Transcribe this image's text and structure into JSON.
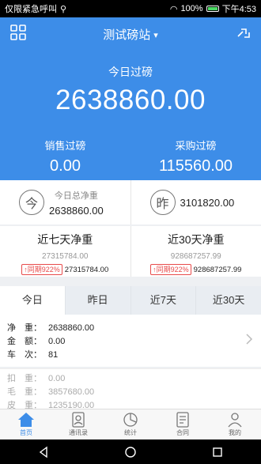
{
  "status": {
    "carrier": "仅限紧急呼叫",
    "battery": "100%",
    "time": "下午4:53"
  },
  "header": {
    "title": "测试磅站"
  },
  "summary": {
    "today_label": "今日过磅",
    "today_value": "2638860.00",
    "sales_label": "销售过磅",
    "sales_value": "0.00",
    "purchase_label": "采购过磅",
    "purchase_value": "115560.00"
  },
  "totals": {
    "today_icon": "今",
    "today_caption": "今日总净重",
    "today_value": "2638860.00",
    "yesterday_icon": "昨",
    "yesterday_value": "3101820.00"
  },
  "periods": [
    {
      "title": "近七天净重",
      "value": "27315784.00",
      "badge": "同期922%",
      "compare": "27315784.00"
    },
    {
      "title": "近30天净重",
      "value": "928687257.99",
      "badge": "同期922%",
      "compare": "928687257.99"
    }
  ],
  "tabs": [
    "今日",
    "昨日",
    "近7天",
    "近30天"
  ],
  "detail": {
    "net_label": "净　重：",
    "net_value": "2638860.00",
    "amount_label": "金　额：",
    "amount_value": "0.00",
    "trips_label": "车　次：",
    "trips_value": "81"
  },
  "detail2": {
    "deduct_label": "扣　重：",
    "deduct_value": "0.00",
    "gross_label": "毛　重：",
    "gross_value": "3857680.00",
    "tare_label": "皮　重：",
    "tare_value": "1235190.00"
  },
  "tabbar": [
    {
      "label": "首页",
      "icon": "home-icon"
    },
    {
      "label": "通讯录",
      "icon": "contacts-icon"
    },
    {
      "label": "统计",
      "icon": "chart-icon"
    },
    {
      "label": "合同",
      "icon": "contract-icon"
    },
    {
      "label": "我的",
      "icon": "profile-icon"
    }
  ],
  "colors": {
    "primary": "#3d8de8",
    "badge": "#e84b4b"
  }
}
